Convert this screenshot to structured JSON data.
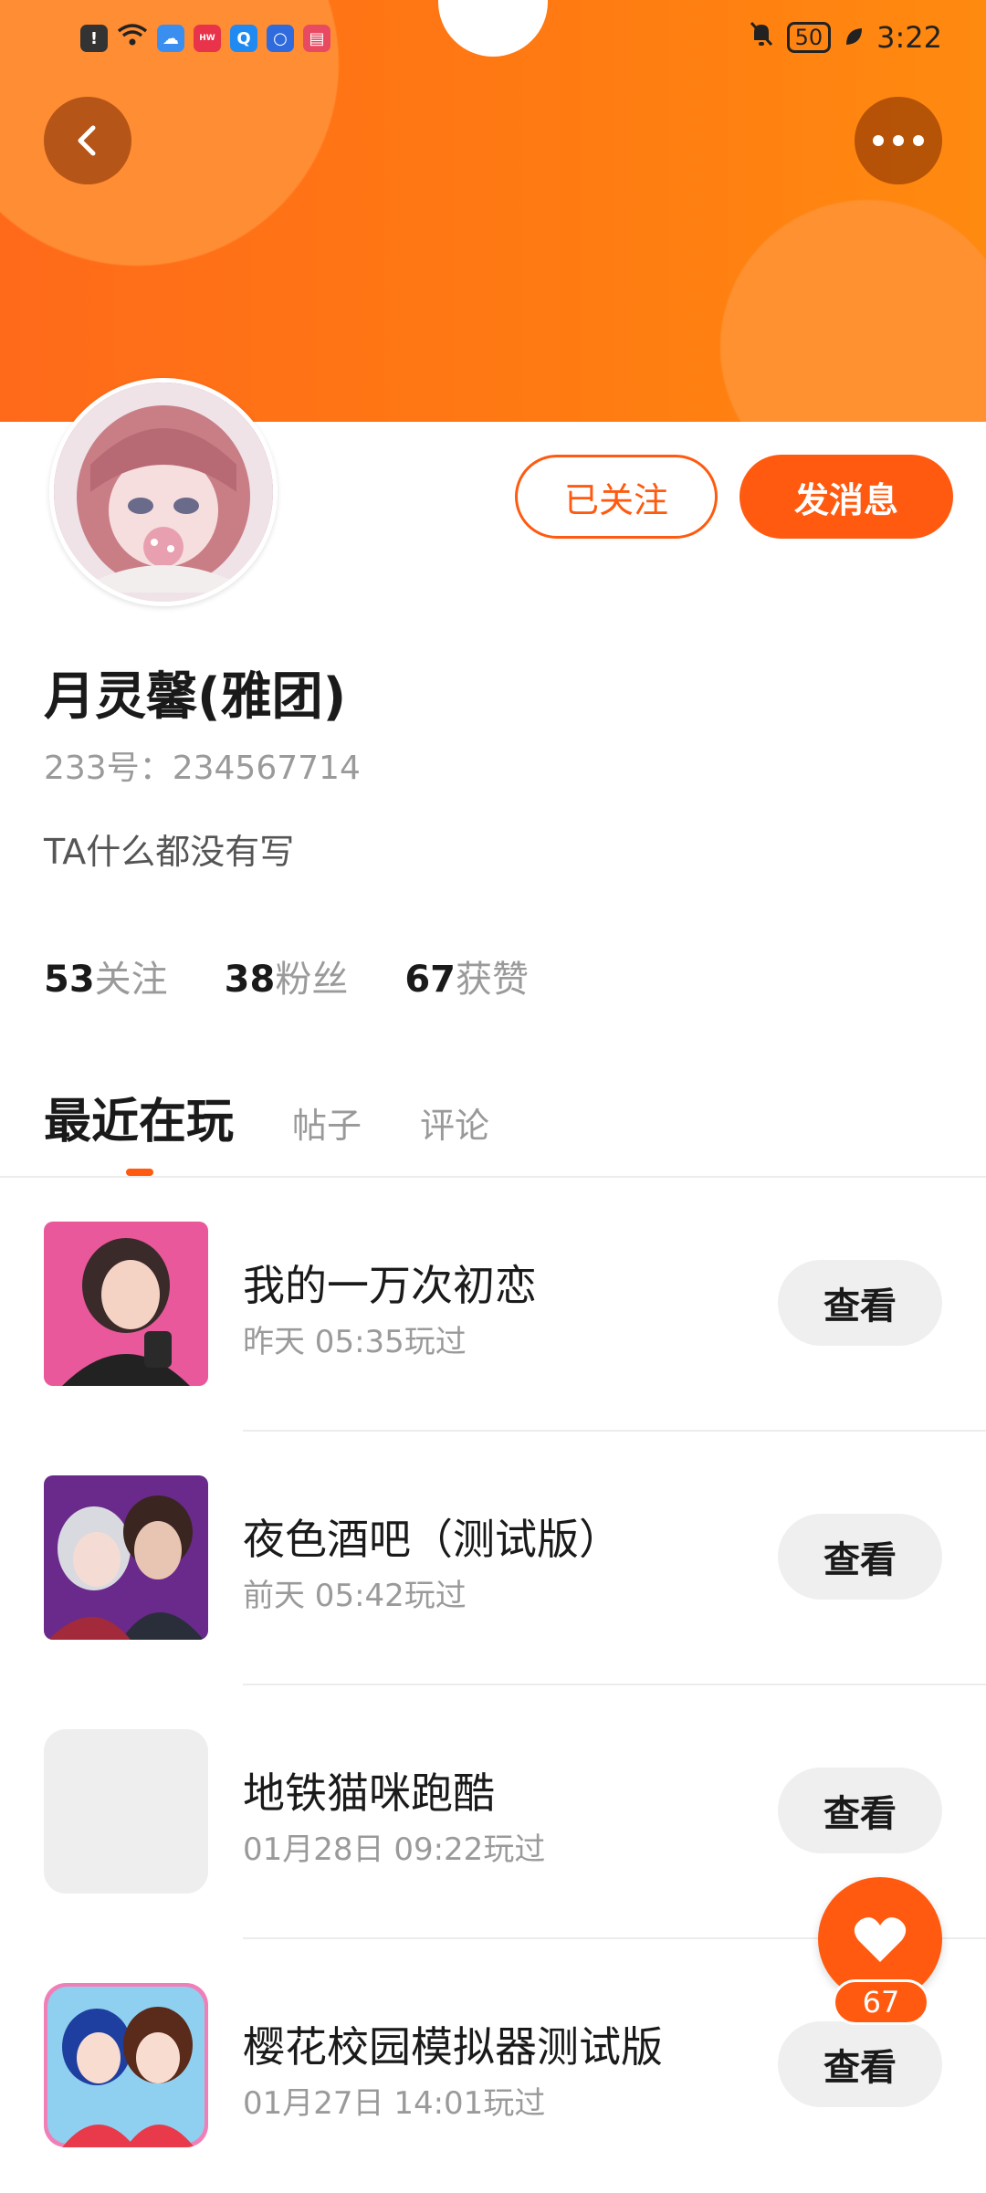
{
  "status_bar": {
    "icons": [
      "alert-icon",
      "wifi-icon",
      "cloud-icon",
      "huawei-app-icon",
      "search-app-icon",
      "bulb-app-icon",
      "book-app-icon"
    ],
    "mute_icon": "bell-off-icon",
    "battery": "50",
    "time": "3:22"
  },
  "header": {
    "back_icon": "chevron-left-icon",
    "more_icon": "more-dots-icon",
    "accent_color": "#ff5a0f"
  },
  "profile": {
    "name": "月灵馨(雅团)",
    "uid": "233号：234567714",
    "bio": "TA什么都没有写",
    "followed_label": "已关注",
    "message_label": "发消息"
  },
  "stats": [
    {
      "num": "53",
      "label": "关注"
    },
    {
      "num": "38",
      "label": "粉丝"
    },
    {
      "num": "67",
      "label": "获赞"
    }
  ],
  "tabs": [
    {
      "label": "最近在玩",
      "active": true
    },
    {
      "label": "帖子",
      "active": false
    },
    {
      "label": "评论",
      "active": false
    }
  ],
  "games": [
    {
      "title": "我的一万次初恋",
      "time": "昨天 05:35玩过",
      "button": "查看"
    },
    {
      "title": "夜色酒吧（测试版）",
      "time": "前天 05:42玩过",
      "button": "查看"
    },
    {
      "title": "地铁猫咪跑酷",
      "time": "01月28日 09:22玩过",
      "button": "查看"
    },
    {
      "title": "樱花校园模拟器测试版",
      "time": "01月27日 14:01玩过",
      "button": "查看"
    }
  ],
  "like_fab": {
    "icon": "heart-icon",
    "count": "67"
  }
}
